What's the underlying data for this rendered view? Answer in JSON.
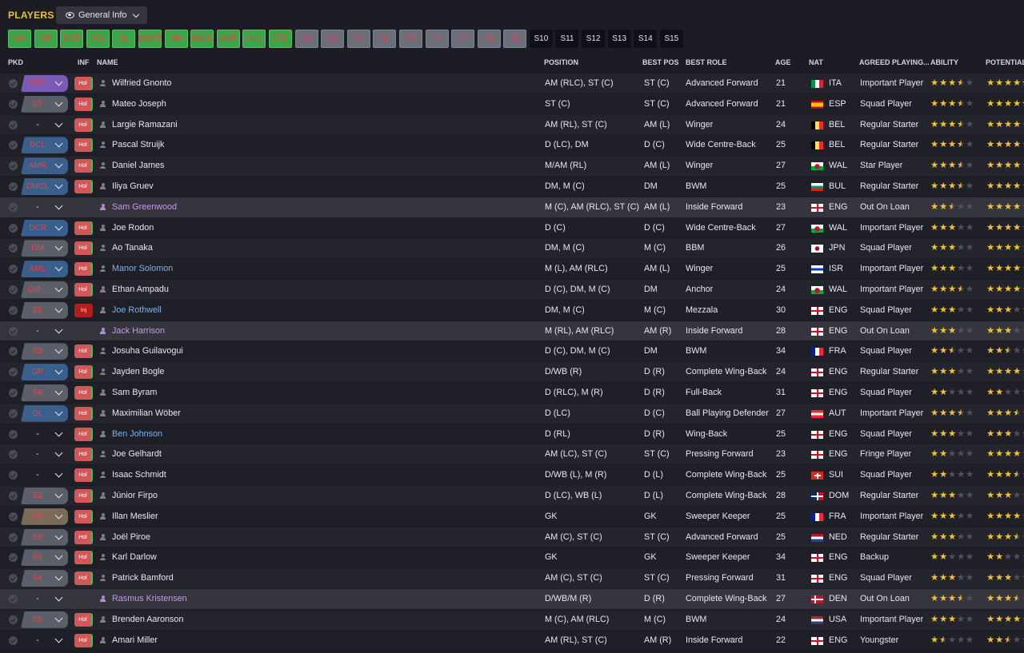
{
  "header": {
    "title": "PLAYERS",
    "view_label": "General Info"
  },
  "position_filters": [
    {
      "label": "GK",
      "style": "green"
    },
    {
      "label": "DR",
      "style": "green"
    },
    {
      "label": "DCR",
      "style": "green"
    },
    {
      "label": "DCL",
      "style": "green"
    },
    {
      "label": "DL",
      "style": "green"
    },
    {
      "label": "DMCR",
      "style": "green"
    },
    {
      "label": "DM",
      "style": "green"
    },
    {
      "label": "DMCL",
      "style": "green"
    },
    {
      "label": "AMR",
      "style": "green"
    },
    {
      "label": "AML",
      "style": "green"
    },
    {
      "label": "STC",
      "style": "green"
    },
    {
      "label": "S1",
      "style": "grey"
    },
    {
      "label": "S2",
      "style": "grey"
    },
    {
      "label": "S3",
      "style": "grey"
    },
    {
      "label": "S4",
      "style": "grey"
    },
    {
      "label": "S5",
      "style": "grey"
    },
    {
      "label": "S6",
      "style": "grey"
    },
    {
      "label": "S7",
      "style": "grey"
    },
    {
      "label": "S8",
      "style": "grey"
    },
    {
      "label": "S9",
      "style": "grey"
    },
    {
      "label": "S10",
      "style": "dark"
    },
    {
      "label": "S11",
      "style": "dark"
    },
    {
      "label": "S12",
      "style": "dark"
    },
    {
      "label": "S13",
      "style": "dark"
    },
    {
      "label": "S14",
      "style": "dark"
    },
    {
      "label": "S15",
      "style": "dark"
    }
  ],
  "columns": {
    "pkd": "PKD",
    "inf": "INF",
    "name": "NAME",
    "position": "POSITION",
    "best_pos": "BEST POS",
    "best_role": "BEST ROLE",
    "age": "AGE",
    "nat": "NAT",
    "agreed": "AGREED PLAYING...",
    "ability": "ABILITY",
    "potential": "POTENTIAL"
  },
  "players": [
    {
      "pkd": "STC",
      "pkd_color": "att",
      "inf": "Hol",
      "status": "normal",
      "name": "Wilfried Gnonto",
      "position": "AM (RLC), ST (C)",
      "best_pos": "ST (C)",
      "best_role": "Advanced Forward",
      "age": "21",
      "nat": "ITA",
      "agreed": "Important Player",
      "ability": 3.5,
      "potential": 5
    },
    {
      "pkd": "ST",
      "pkd_color": "mid",
      "inf": "Hol",
      "status": "normal",
      "name": "Mateo Joseph",
      "position": "ST (C)",
      "best_pos": "ST (C)",
      "best_role": "Advanced Forward",
      "age": "21",
      "nat": "ESP",
      "agreed": "Squad Player",
      "ability": 3.5,
      "potential": 4.5
    },
    {
      "pkd": "-",
      "pkd_color": "none",
      "inf": "Hol",
      "status": "normal",
      "name": "Largie Ramazani",
      "position": "AM (RL), ST (C)",
      "best_pos": "AM (L)",
      "best_role": "Winger",
      "age": "24",
      "nat": "BEL",
      "agreed": "Regular Starter",
      "ability": 3.5,
      "potential": 4
    },
    {
      "pkd": "DCL",
      "pkd_color": "def",
      "inf": "Hol",
      "status": "normal",
      "name": "Pascal Struijk",
      "position": "D (LC), DM",
      "best_pos": "D (C)",
      "best_role": "Wide Centre-Back",
      "age": "25",
      "nat": "BEL",
      "agreed": "Regular Starter",
      "ability": 3.5,
      "potential": 4
    },
    {
      "pkd": "AMR",
      "pkd_color": "def",
      "inf": "Hol",
      "status": "normal",
      "name": "Daniel James",
      "position": "M/AM (RL)",
      "best_pos": "AM (L)",
      "best_role": "Winger",
      "age": "27",
      "nat": "WAL",
      "agreed": "Star Player",
      "ability": 3.5,
      "potential": 4
    },
    {
      "pkd": "DMCL",
      "pkd_color": "def",
      "inf": "Hol",
      "status": "normal",
      "name": "Iliya Gruev",
      "position": "DM, M (C)",
      "best_pos": "DM",
      "best_role": "BWM",
      "age": "25",
      "nat": "BUL",
      "agreed": "Regular Starter",
      "ability": 3.5,
      "potential": 4
    },
    {
      "pkd": "-",
      "pkd_color": "none",
      "inf": "",
      "status": "loan",
      "name": "Sam Greenwood",
      "position": "M (C), AM (RLC), ST (C)",
      "best_pos": "AM (L)",
      "best_role": "Inside Forward",
      "age": "23",
      "nat": "ENG",
      "agreed": "Out On Loan",
      "ability": 2.5,
      "potential": 4
    },
    {
      "pkd": "DCR",
      "pkd_color": "def",
      "inf": "Hol",
      "status": "normal",
      "name": "Joe Rodon",
      "position": "D (C)",
      "best_pos": "D (C)",
      "best_role": "Wide Centre-Back",
      "age": "27",
      "nat": "WAL",
      "agreed": "Important Player",
      "ability": 3,
      "potential": 4
    },
    {
      "pkd": "DM",
      "pkd_color": "mid",
      "inf": "Hol",
      "status": "normal",
      "name": "Ao Tanaka",
      "position": "DM, M (C)",
      "best_pos": "M (C)",
      "best_role": "BBM",
      "age": "26",
      "nat": "JPN",
      "agreed": "Squad Player",
      "ability": 3,
      "potential": 4
    },
    {
      "pkd": "AML",
      "pkd_color": "def",
      "inf": "Hol",
      "status": "link",
      "name": "Manor Solomon",
      "position": "M (L), AM (RLC)",
      "best_pos": "AM (L)",
      "best_role": "Winger",
      "age": "25",
      "nat": "ISR",
      "agreed": "Important Player",
      "ability": 3,
      "potential": 4
    },
    {
      "pkd": "DM...",
      "pkd_color": "mid",
      "inf": "Hol",
      "status": "normal",
      "name": "Ethan Ampadu",
      "position": "D (C), DM, M (C)",
      "best_pos": "DM",
      "best_role": "Anchor",
      "age": "24",
      "nat": "WAL",
      "agreed": "Important Player",
      "ability": 3.5,
      "potential": 4
    },
    {
      "pkd": "S6",
      "pkd_color": "mid",
      "inf": "Inj",
      "status": "link",
      "name": "Joe Rothwell",
      "position": "DM, M (C)",
      "best_pos": "M (C)",
      "best_role": "Mezzala",
      "age": "30",
      "nat": "ENG",
      "agreed": "Squad Player",
      "ability": 3,
      "potential": 3
    },
    {
      "pkd": "-",
      "pkd_color": "none",
      "inf": "",
      "status": "loan",
      "name": "Jack Harrison",
      "position": "M (RL), AM (RLC)",
      "best_pos": "AM (R)",
      "best_role": "Inside Forward",
      "age": "28",
      "nat": "ENG",
      "agreed": "Out On Loan",
      "ability": 3,
      "potential": 3
    },
    {
      "pkd": "S3",
      "pkd_color": "mid",
      "inf": "Hol",
      "status": "normal",
      "name": "Josuha Guilavogui",
      "position": "D (C), DM, M (C)",
      "best_pos": "DM",
      "best_role": "BWM",
      "age": "34",
      "nat": "FRA",
      "agreed": "Squad Player",
      "ability": 2.5,
      "potential": 2.5
    },
    {
      "pkd": "DR",
      "pkd_color": "def",
      "inf": "Hol",
      "status": "normal",
      "name": "Jayden Bogle",
      "position": "D/WB (R)",
      "best_pos": "D (R)",
      "best_role": "Complete Wing-Back",
      "age": "24",
      "nat": "ENG",
      "agreed": "Regular Starter",
      "ability": 3,
      "potential": 4
    },
    {
      "pkd": "S8",
      "pkd_color": "mid",
      "inf": "Hol",
      "status": "normal",
      "name": "Sam Byram",
      "position": "D (RLC), M (R)",
      "best_pos": "D (R)",
      "best_role": "Full-Back",
      "age": "31",
      "nat": "ENG",
      "agreed": "Squad Player",
      "ability": 2,
      "potential": 2
    },
    {
      "pkd": "DL",
      "pkd_color": "def",
      "inf": "Hol",
      "status": "normal",
      "name": "Maximilian Wöber",
      "position": "D (LC)",
      "best_pos": "D (C)",
      "best_role": "Ball Playing Defender",
      "age": "27",
      "nat": "AUT",
      "agreed": "Important Player",
      "ability": 3.5,
      "potential": 3.5
    },
    {
      "pkd": "-",
      "pkd_color": "none",
      "inf": "Hol",
      "status": "link",
      "name": "Ben Johnson",
      "position": "D (RL)",
      "best_pos": "D (R)",
      "best_role": "Wing-Back",
      "age": "25",
      "nat": "ENG",
      "agreed": "Squad Player",
      "ability": 3,
      "potential": 3
    },
    {
      "pkd": "-",
      "pkd_color": "none",
      "inf": "Hol",
      "status": "normal",
      "name": "Joe Gelhardt",
      "position": "AM (LC), ST (C)",
      "best_pos": "ST (C)",
      "best_role": "Pressing Forward",
      "age": "23",
      "nat": "ENG",
      "agreed": "Fringe Player",
      "ability": 2,
      "potential": 4
    },
    {
      "pkd": "-",
      "pkd_color": "none",
      "inf": "Hol",
      "status": "normal",
      "name": "Isaac Schmidt",
      "position": "D/WB (L), M (R)",
      "best_pos": "D (L)",
      "best_role": "Complete Wing-Back",
      "age": "25",
      "nat": "SUI",
      "agreed": "Squad Player",
      "ability": 2,
      "potential": 3.5
    },
    {
      "pkd": "S2",
      "pkd_color": "mid",
      "inf": "Hol",
      "status": "normal",
      "name": "Júnior Firpo",
      "position": "D (LC), WB (L)",
      "best_pos": "D (L)",
      "best_role": "Complete Wing-Back",
      "age": "28",
      "nat": "DOM",
      "agreed": "Regular Starter",
      "ability": 3,
      "potential": 3
    },
    {
      "pkd": "GK",
      "pkd_color": "gk",
      "inf": "Hol",
      "status": "normal",
      "name": "Illan Meslier",
      "position": "GK",
      "best_pos": "GK",
      "best_role": "Sweeper Keeper",
      "age": "25",
      "nat": "FRA",
      "agreed": "Important Player",
      "ability": 3,
      "potential": 4
    },
    {
      "pkd": "S9",
      "pkd_color": "mid",
      "inf": "Hol",
      "status": "normal",
      "name": "Joël Piroe",
      "position": "AM (C), ST (C)",
      "best_pos": "ST (C)",
      "best_role": "Advanced Forward",
      "age": "25",
      "nat": "NED",
      "agreed": "Regular Starter",
      "ability": 3,
      "potential": 3.5
    },
    {
      "pkd": "S1",
      "pkd_color": "mid",
      "inf": "Hol",
      "status": "normal",
      "name": "Karl Darlow",
      "position": "GK",
      "best_pos": "GK",
      "best_role": "Sweeper Keeper",
      "age": "34",
      "nat": "ENG",
      "agreed": "Backup",
      "ability": 2,
      "potential": 2
    },
    {
      "pkd": "S4",
      "pkd_color": "mid",
      "inf": "Hol",
      "status": "normal",
      "name": "Patrick Bamford",
      "position": "AM (C), ST (C)",
      "best_pos": "ST (C)",
      "best_role": "Pressing Forward",
      "age": "31",
      "nat": "ENG",
      "agreed": "Squad Player",
      "ability": 3,
      "potential": 3
    },
    {
      "pkd": "-",
      "pkd_color": "none",
      "inf": "",
      "status": "loan",
      "name": "Rasmus Kristensen",
      "position": "D/WB/M (R)",
      "best_pos": "D (R)",
      "best_role": "Complete Wing-Back",
      "age": "27",
      "nat": "DEN",
      "agreed": "Out On Loan",
      "ability": 3.5,
      "potential": 3.5
    },
    {
      "pkd": "S5",
      "pkd_color": "mid",
      "inf": "Hol",
      "status": "normal",
      "name": "Brenden Aaronson",
      "position": "M (C), AM (RLC)",
      "best_pos": "M (C)",
      "best_role": "BWM",
      "age": "24",
      "nat": "USA",
      "agreed": "Important Player",
      "ability": 3,
      "potential": 4
    },
    {
      "pkd": "-",
      "pkd_color": "none",
      "inf": "Hol",
      "status": "normal",
      "name": "Amari Miller",
      "position": "AM (RL), ST (C)",
      "best_pos": "AM (R)",
      "best_role": "Inside Forward",
      "age": "22",
      "nat": "ENG",
      "agreed": "Youngster",
      "ability": 1.5,
      "potential": 2.5
    }
  ],
  "flag_colors": {
    "ITA": [
      "#009246",
      "#ffffff",
      "#ce2b37"
    ],
    "ESP": [
      "#c60b1e",
      "#ffc400",
      "#c60b1e"
    ],
    "BEL": [
      "#000000",
      "#fae042",
      "#ed2939"
    ],
    "WAL": [
      "#ffffff",
      "#00ab39",
      "#d30731"
    ],
    "BUL": [
      "#ffffff",
      "#00966e",
      "#d62612"
    ],
    "ENG": [
      "#ffffff",
      "#ce1124",
      "#ffffff"
    ],
    "JPN": [
      "#ffffff",
      "#bc002d",
      "#ffffff"
    ],
    "ISR": [
      "#ffffff",
      "#0038b8",
      "#ffffff"
    ],
    "FRA": [
      "#002395",
      "#ffffff",
      "#ed2939"
    ],
    "AUT": [
      "#ed2939",
      "#ffffff",
      "#ed2939"
    ],
    "SUI": [
      "#d52b1e",
      "#ffffff",
      "#d52b1e"
    ],
    "DOM": [
      "#002d62",
      "#ffffff",
      "#ce1126"
    ],
    "NED": [
      "#ae1c28",
      "#ffffff",
      "#21468b"
    ],
    "DEN": [
      "#c8102e",
      "#ffffff",
      "#c8102e"
    ],
    "USA": [
      "#b22234",
      "#ffffff",
      "#3c3b6e"
    ]
  }
}
